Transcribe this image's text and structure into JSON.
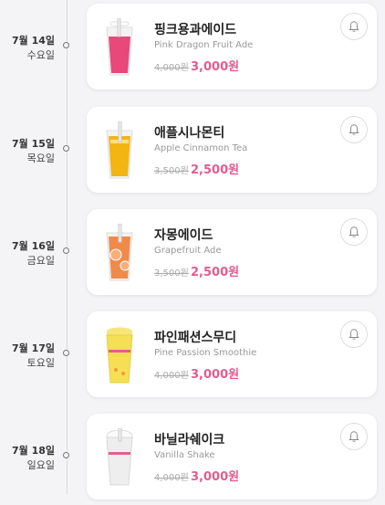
{
  "items": [
    {
      "date": "7월 14일",
      "weekday": "수요일",
      "name_ko": "핑크용과에이드",
      "name_en": "Pink Dragon Fruit Ade",
      "price_old": "4,000원",
      "price_new": "3,000원",
      "drink_color": "#e8487a"
    },
    {
      "date": "7월 15일",
      "weekday": "목요일",
      "name_ko": "애플시나몬티",
      "name_en": "Apple Cinnamon Tea",
      "price_old": "3,500원",
      "price_new": "2,500원",
      "drink_color": "#f2b512"
    },
    {
      "date": "7월 16일",
      "weekday": "금요일",
      "name_ko": "자몽에이드",
      "name_en": "Grapefruit Ade",
      "price_old": "3,500원",
      "price_new": "2,500원",
      "drink_color": "#f08a4a"
    },
    {
      "date": "7월 17일",
      "weekday": "토요일",
      "name_ko": "파인패션스무디",
      "name_en": "Pine Passion Smoothie",
      "price_old": "4,000원",
      "price_new": "3,000원",
      "drink_color": "#f6df55"
    },
    {
      "date": "7월 18일",
      "weekday": "일요일",
      "name_ko": "바닐라쉐이크",
      "name_en": "Vanilla Shake",
      "price_old": "4,000원",
      "price_new": "3,000원",
      "drink_color": "#eeeeee"
    }
  ],
  "icons": {
    "bell": "bell-icon"
  },
  "colors": {
    "accent": "#e45c8d"
  }
}
